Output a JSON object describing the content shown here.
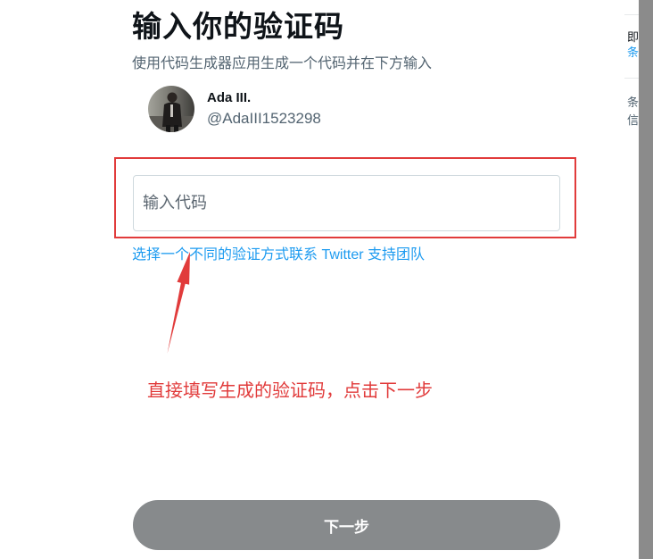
{
  "dialog": {
    "title": "输入你的验证码",
    "subtitle": "使用代码生成器应用生成一个代码并在下方输入",
    "account": {
      "name": "Ada III.",
      "handle": "@AdaIII1523298"
    },
    "code_input": {
      "placeholder": "输入代码",
      "value": ""
    },
    "links": {
      "choose_method": "选择一个不同的验证方式",
      "contact_support": "联系 Twitter 支持团队"
    },
    "next_button": {
      "label": "下一步",
      "disabled": true
    }
  },
  "annotation": {
    "note": "直接填写生成的验证码，点击下一步",
    "arrow_icon": "arrow-icon"
  },
  "sidebar_fragment": {
    "lines": [
      {
        "text": "即"
      },
      {
        "text": "条"
      },
      {
        "text": "条"
      },
      {
        "text": "信"
      }
    ]
  },
  "colors": {
    "text_primary": "#0f1419",
    "text_secondary": "#536471",
    "link": "#1d9bf0",
    "annotation_red": "#e13b3b",
    "button_disabled": "#878a8c",
    "input_border": "#cfd9de",
    "scrollbar": "#8b8b8b"
  }
}
